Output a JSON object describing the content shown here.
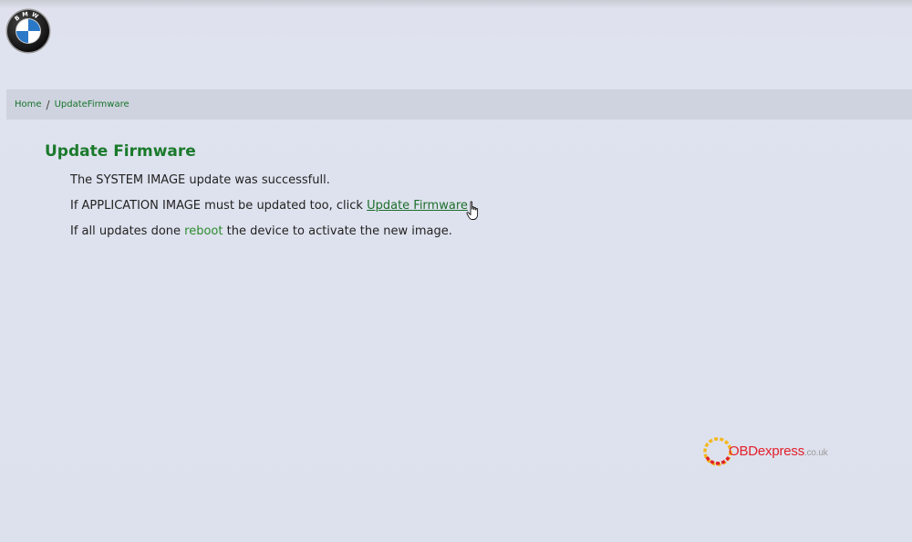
{
  "brand": {
    "logo_icon": "bmw-roundel-icon",
    "logo_letters": "BMW"
  },
  "breadcrumb": {
    "home": "Home",
    "separator": "/",
    "current": "UpdateFirmware"
  },
  "content": {
    "title": "Update Firmware",
    "line1": "The SYSTEM IMAGE update was successfull.",
    "line2_prefix": "If APPLICATION IMAGE must be updated too, click ",
    "line2_link": "Update Firmware",
    "line3_prefix": "If all updates done ",
    "line3_link": "reboot",
    "line3_suffix": " the device to activate the new image."
  },
  "watermark": {
    "name": "OBDexpress",
    "suffix": ".co.uk"
  },
  "colors": {
    "background": "#dfe3ef",
    "breadcrumb_bar": "#cfd3df",
    "title_green": "#1b7a2c",
    "link_green": "#1d6e2c",
    "watermark_red": "#e3202a"
  }
}
